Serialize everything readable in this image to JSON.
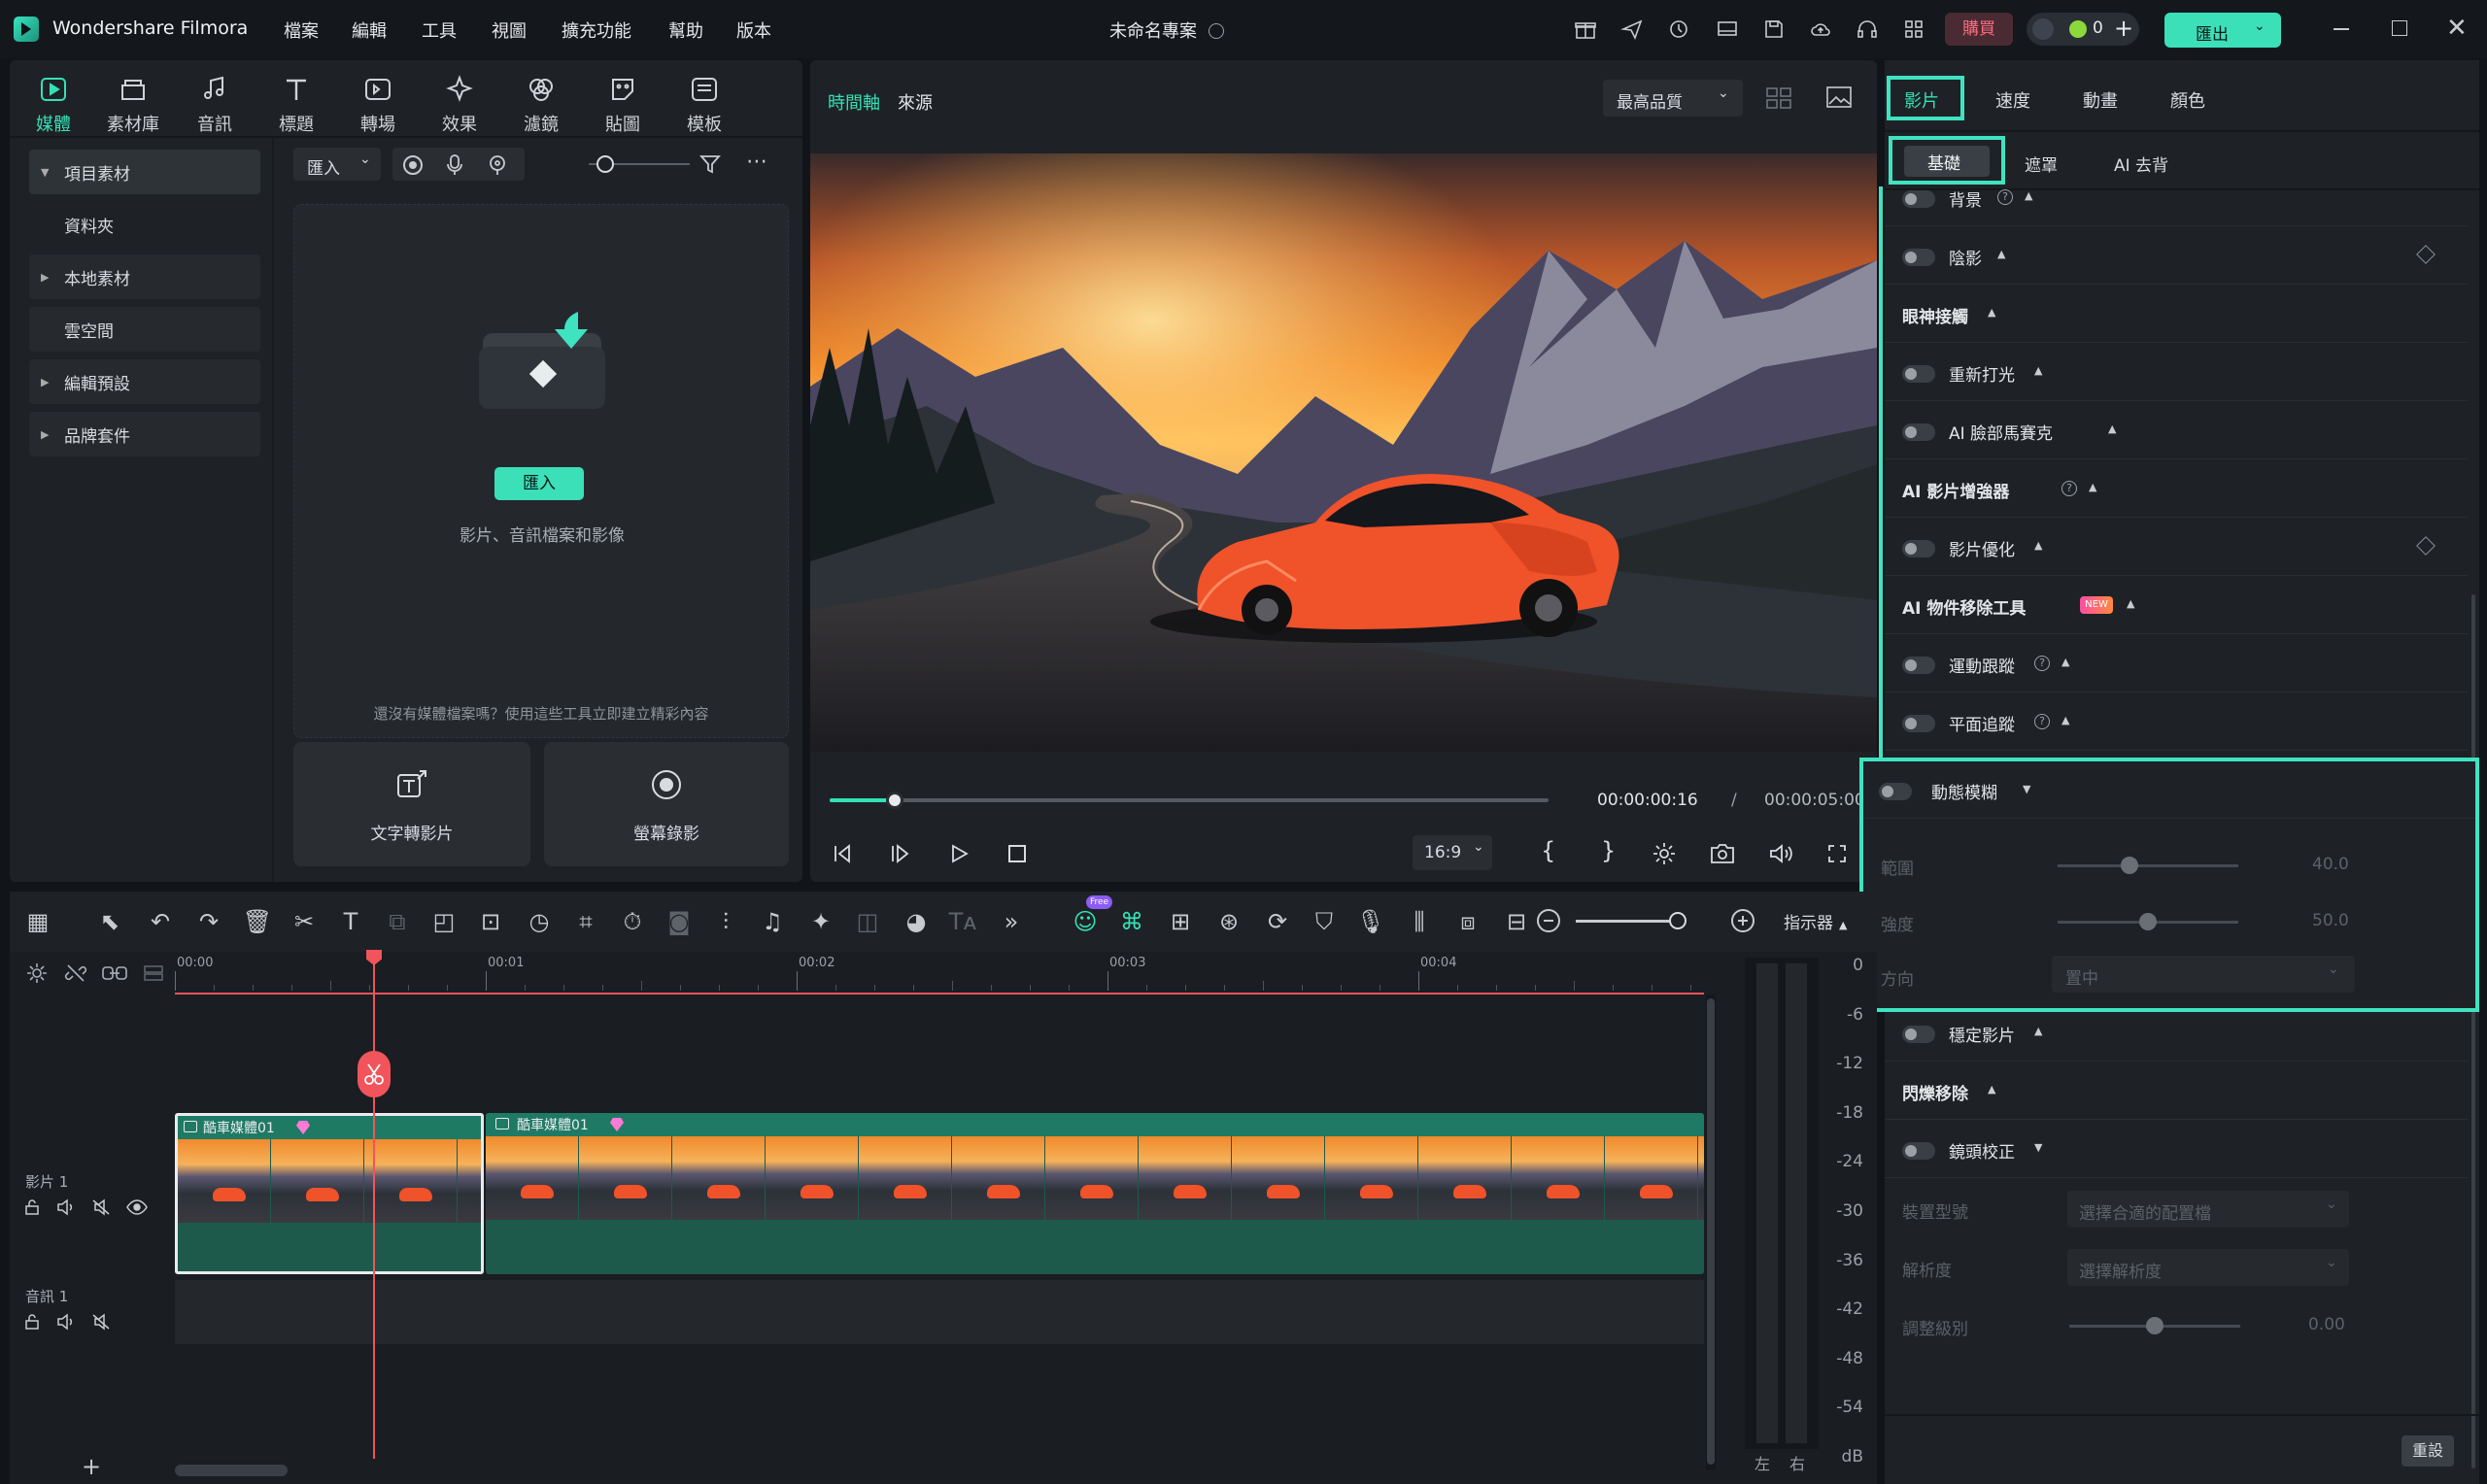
{
  "app": {
    "title": "Wondershare Filmora",
    "project": "未命名專案",
    "buy": "購買",
    "points": "0",
    "export": "匯出"
  },
  "menu": [
    "檔案",
    "編輯",
    "工具",
    "視圖",
    "擴充功能",
    "幫助",
    "版本"
  ],
  "media_tabs": [
    "媒體",
    "素材庫",
    "音訊",
    "標題",
    "轉場",
    "效果",
    "濾鏡",
    "貼圖",
    "模板"
  ],
  "sidebar": {
    "items": [
      "項目素材",
      "資料夾",
      "本地素材",
      "雲空間",
      "編輯預設",
      "品牌套件"
    ]
  },
  "media": {
    "import_dropdown": "匯入",
    "import_button": "匯入",
    "hint": "影片、音訊檔案和影像",
    "no_media": "還沒有媒體檔案嗎？使用這些工具立即建立精彩內容",
    "card1": "文字轉影片",
    "card2": "螢幕錄影"
  },
  "preview": {
    "tab_timeline": "時間軸",
    "tab_source": "來源",
    "quality": "最高品質",
    "time_current": "00:00:00:16",
    "time_sep": "/",
    "time_total": "00:00:05:00",
    "ratio": "16:9",
    "progress": 0.09
  },
  "right_panel": {
    "tabs": [
      "影片",
      "速度",
      "動畫",
      "顏色"
    ],
    "subtabs": [
      "基礎",
      "遮罩",
      "AI 去背"
    ],
    "props": [
      {
        "label": "背景",
        "toggle": true
      },
      {
        "label": "陰影",
        "toggle": true
      },
      {
        "label": "眼神接觸",
        "toggle": false
      },
      {
        "label": "重新打光",
        "toggle": true
      },
      {
        "label": "AI 臉部馬賽克",
        "toggle": true
      },
      {
        "label": "AI 影片增強器",
        "toggle": false
      },
      {
        "label": "影片優化",
        "toggle": true
      },
      {
        "label": "AI 物件移除工具",
        "toggle": false,
        "badge": "NEW"
      },
      {
        "label": "運動跟蹤",
        "toggle": true
      },
      {
        "label": "平面追蹤",
        "toggle": true
      }
    ],
    "motion_blur": {
      "label": "動態模糊",
      "range_label": "範圍",
      "range_value": "40.0",
      "range_level": 0.4,
      "strength_label": "強度",
      "strength_value": "50.0",
      "strength_level": 0.5,
      "direction_label": "方向",
      "direction_value": "置中"
    },
    "props2": [
      {
        "label": "穩定影片",
        "toggle": true
      },
      {
        "label": "閃爍移除",
        "toggle": false
      },
      {
        "label": "鏡頭校正",
        "toggle": true
      }
    ],
    "lens": {
      "device_label": "裝置型號",
      "device_value": "選擇合適的配置檔",
      "res_label": "解析度",
      "res_value": "選擇解析度",
      "adjust_label": "調整級別",
      "adjust_value": "0.00",
      "adjust_level": 0.5
    },
    "reset": "重設"
  },
  "timeline": {
    "ruler": [
      "00:00",
      "00:01",
      "00:02",
      "00:03",
      "00:04"
    ],
    "indicator": "指示器",
    "track_video": "影片 1",
    "track_audio": "音訊 1",
    "clip_name": "酷車媒體01",
    "free_badge": "Free",
    "db_scale": [
      "0",
      "-6",
      "-12",
      "-18",
      "-24",
      "-30",
      "-36",
      "-42",
      "-48",
      "-54",
      "dB"
    ],
    "meter_lr": [
      "左",
      "右"
    ]
  },
  "colors": {
    "accent": "#35e0b6",
    "highlight": "#3fe3c1",
    "playhead": "#f2545b",
    "clip": "#1f7a64"
  }
}
